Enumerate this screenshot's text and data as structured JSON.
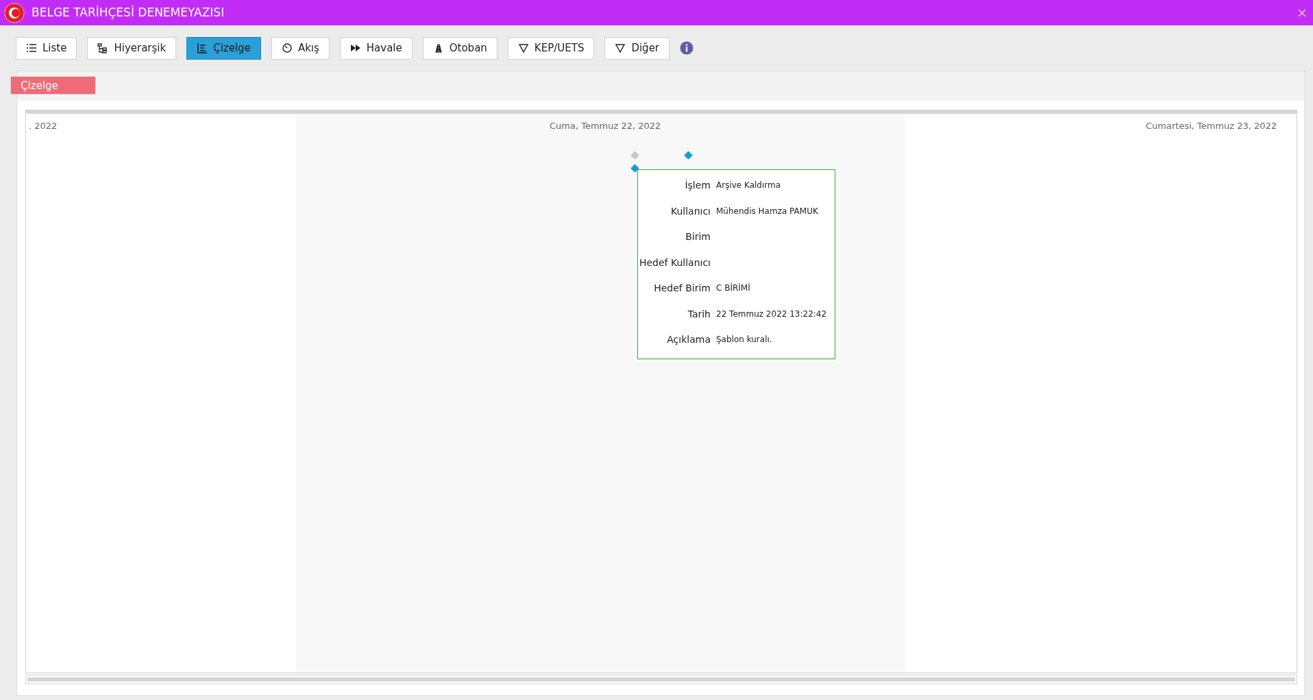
{
  "window": {
    "title": "BELGE TARİHÇESİ DENEMEYAZISI"
  },
  "toolbar": [
    {
      "label": "Liste",
      "selected": false
    },
    {
      "label": "Hiyerarşik",
      "selected": false
    },
    {
      "label": "Çizelge",
      "selected": true
    },
    {
      "label": "Akış",
      "selected": false
    },
    {
      "label": "Havale",
      "selected": false
    },
    {
      "label": "Otoban",
      "selected": false
    },
    {
      "label": "KEP/UETS",
      "selected": false
    },
    {
      "label": "Diğer",
      "selected": false
    }
  ],
  "panel_tab": "Çizelge",
  "timeline": {
    "dates": [
      ". 2022",
      "Cuma, Temmuz 22, 2022",
      "Cumartesi, Temmuz 23, 2022"
    ],
    "markers": [
      {
        "color": "#c8c8c8"
      },
      {
        "color": "#1e9ad6"
      },
      {
        "color": "#1e9ad6"
      }
    ],
    "tooltip": [
      {
        "label": "İşlem",
        "value": "Arşive Kaldırma"
      },
      {
        "label": "Kullanıcı",
        "value": "Mühendis Hamza PAMUK"
      },
      {
        "label": "Birim"
      },
      {
        "label": "Hedef Kullanıcı"
      },
      {
        "label": "Hedef Birim",
        "value": "C BİRİMİ"
      },
      {
        "label": "Tarih",
        "value": "22 Temmuz 2022 13:22:42"
      },
      {
        "label": "Açıklama",
        "value": "Şablon kuralı."
      }
    ]
  }
}
